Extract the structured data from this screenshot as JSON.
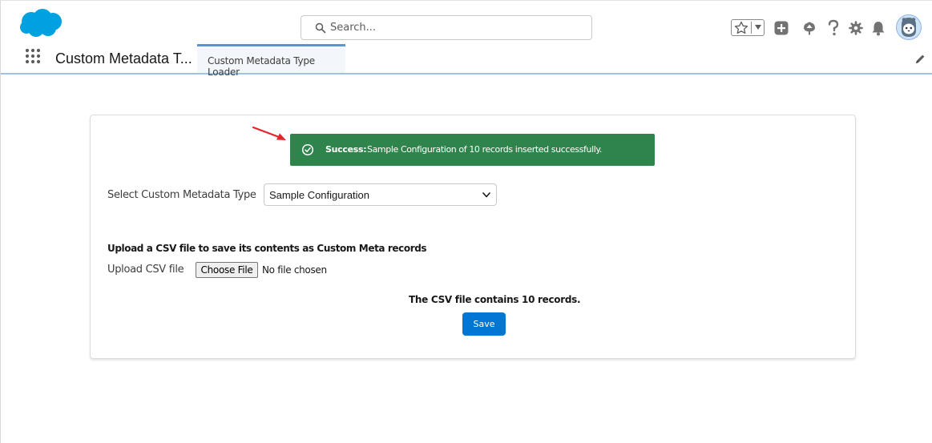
{
  "header": {
    "search_placeholder": "Search...",
    "icons": [
      "salesforce-cloud-logo",
      "star-icon",
      "chevron-down-icon",
      "plus-icon",
      "trailhead-icon",
      "help-icon",
      "gear-icon",
      "bell-icon",
      "avatar"
    ]
  },
  "nav": {
    "app_name": "Custom Metadata T...",
    "tabs": [
      {
        "label": "Custom Metadata Type Loader",
        "active": true
      }
    ]
  },
  "toast": {
    "title": "Success:",
    "message": "Sample Configuration of 10 records inserted successfully.",
    "color": "#2e844a"
  },
  "form": {
    "select_label": "Select Custom Metadata Type",
    "select_value": "Sample Configuration",
    "upload_heading": "Upload a CSV file to save its contents as Custom Meta records",
    "upload_label": "Upload CSV file",
    "choose_file_label": "Choose File",
    "no_file_text": "No file chosen",
    "record_count_text": "The CSV file contains 10 records.",
    "save_label": "Save"
  },
  "colors": {
    "brand": "#00a1e0",
    "accent": "#0176d3",
    "success": "#2e844a",
    "annotation_arrow": "#e3242b"
  }
}
